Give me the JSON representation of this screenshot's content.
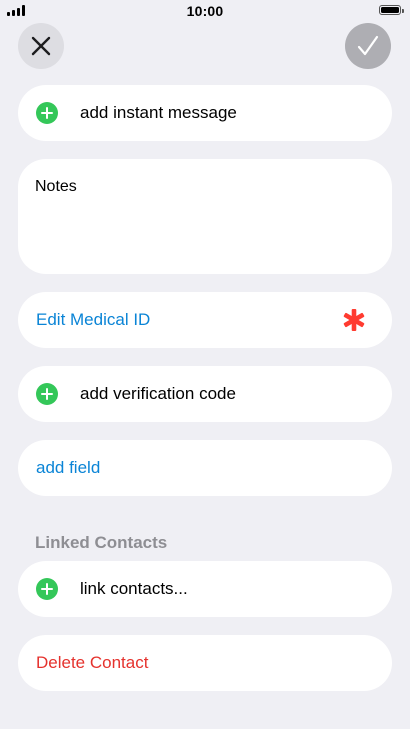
{
  "status_bar": {
    "time": "10:00"
  },
  "header": {
    "close_icon": "close-icon",
    "done_icon": "checkmark-icon"
  },
  "rows": {
    "instant_message": "add instant message",
    "notes_label": "Notes",
    "medical_id": "Edit Medical ID",
    "verification_code": "add verification code",
    "add_field": "add field",
    "linked_contacts_header": "Linked Contacts",
    "link_contacts": "link contacts...",
    "delete_contact": "Delete Contact"
  },
  "colors": {
    "accent_blue": "#0a84d6",
    "add_green": "#34c759",
    "danger_red": "#e5322d",
    "medical_star_red": "#ff3b30",
    "background": "#efeff4"
  }
}
